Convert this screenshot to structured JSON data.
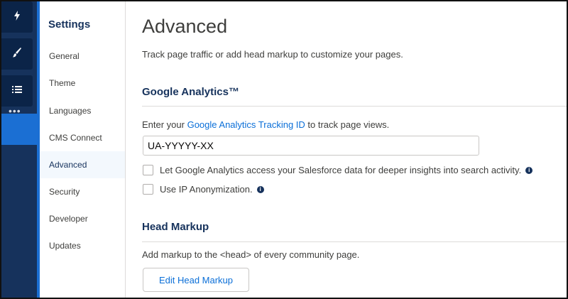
{
  "rail": {
    "icons": [
      "lightning-icon",
      "brush-icon",
      "list-icon",
      "more-dots-icon",
      "gear-icon"
    ]
  },
  "nav": {
    "title": "Settings",
    "items": [
      {
        "label": "General",
        "active": false
      },
      {
        "label": "Theme",
        "active": false
      },
      {
        "label": "Languages",
        "active": false
      },
      {
        "label": "CMS Connect",
        "active": false
      },
      {
        "label": "Advanced",
        "active": true
      },
      {
        "label": "Security",
        "active": false
      },
      {
        "label": "Developer",
        "active": false
      },
      {
        "label": "Updates",
        "active": false
      }
    ]
  },
  "main": {
    "title": "Advanced",
    "description": "Track page traffic or add head markup to customize your pages.",
    "ga": {
      "heading": "Google Analytics™",
      "prompt_before": "Enter your ",
      "prompt_link": "Google Analytics Tracking ID",
      "prompt_after": " to track page views.",
      "tracking_id_value": "UA-YYYYY-XX",
      "checkbox1_label": "Let Google Analytics access your Salesforce data for deeper insights into search activity.",
      "checkbox1_checked": false,
      "checkbox2_label": "Use IP Anonymization.",
      "checkbox2_checked": false
    },
    "head": {
      "heading": "Head Markup",
      "description": "Add markup to the <head> of every community page.",
      "button_label": "Edit Head Markup"
    }
  },
  "colors": {
    "rail_bg": "#16325c",
    "accent": "#1b6fd3",
    "link": "#0b6fd8",
    "heading": "#16325c"
  }
}
